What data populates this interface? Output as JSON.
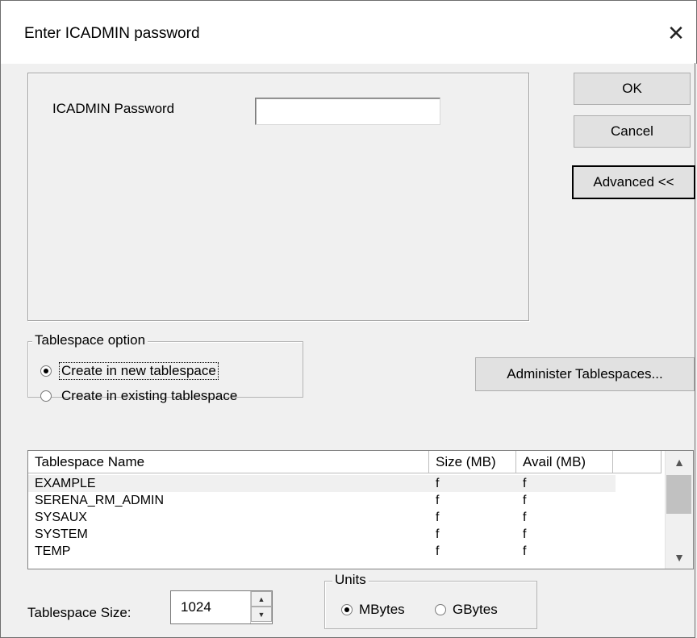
{
  "dialog": {
    "title": "Enter ICADMIN password",
    "close_glyph": "✕"
  },
  "password": {
    "label": "ICADMIN Password",
    "value": ""
  },
  "buttons": {
    "ok": "OK",
    "cancel": "Cancel",
    "advanced": "Advanced <<",
    "administer": "Administer Tablespaces..."
  },
  "tablespace_option": {
    "legend": "Tablespace option",
    "options": [
      {
        "label": "Create in new tablespace",
        "selected": true
      },
      {
        "label": "Create in existing tablespace",
        "selected": false
      }
    ]
  },
  "table": {
    "columns": [
      "Tablespace Name",
      "Size (MB)",
      "Avail (MB)"
    ],
    "rows": [
      [
        "EXAMPLE",
        "f",
        "f"
      ],
      [
        "SERENA_RM_ADMIN",
        "f",
        "f"
      ],
      [
        "SYSAUX",
        "f",
        "f"
      ],
      [
        "SYSTEM",
        "f",
        "f"
      ],
      [
        "TEMP",
        "f",
        "f"
      ]
    ]
  },
  "size": {
    "label": "Tablespace Size:",
    "value": "1024"
  },
  "units": {
    "legend": "Units",
    "options": [
      {
        "label": "MBytes",
        "selected": true
      },
      {
        "label": "GBytes",
        "selected": false
      }
    ]
  }
}
